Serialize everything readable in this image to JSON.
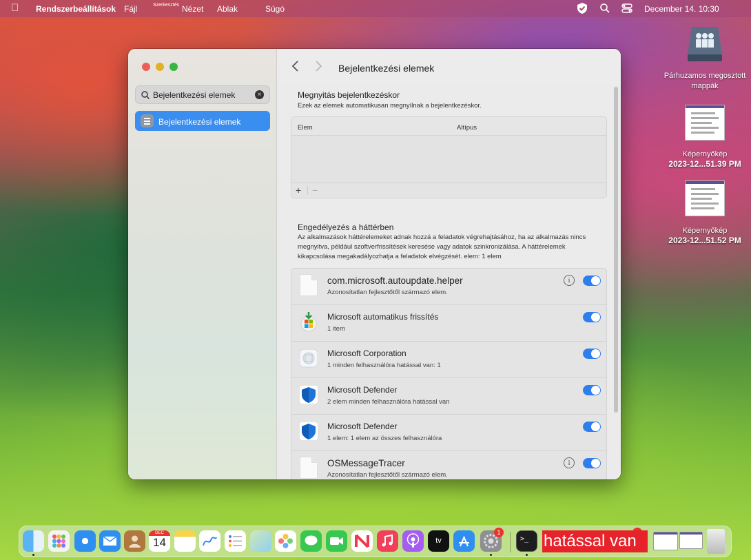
{
  "menubar": {
    "app_name": "Rendszerbeállítások",
    "items": [
      "Fájl",
      "Szerkesztés",
      "Nézet",
      "Ablak",
      "Súgó"
    ],
    "clock": "December 14. 10:30"
  },
  "desktop": {
    "items": [
      {
        "label_1": "Párhuzamos megosztott",
        "label_2": "mappák"
      },
      {
        "label_1": "Képernyőkép",
        "label_2": "2023-12...51.39 PM"
      },
      {
        "label_1": "Képernyőkép",
        "label_2": "2023-12...51.52 PM"
      }
    ]
  },
  "window": {
    "search_value": "Bejelentkezési elemek",
    "sidebar_selected": "Bejelentkezési elemek",
    "title": "Bejelentkezési elemek",
    "open_at_login": {
      "title": "Megnyitás bejelentkezéskor",
      "desc": "Ezek az elemek automatikusan megnyílnak a bejelentkezéskor.",
      "col_item": "Elem",
      "col_kind": "Altípus",
      "add": "+",
      "remove": "−"
    },
    "background": {
      "title": "Engedélyezés a háttérben",
      "desc": "Az alkalmazások háttérelemeket adnak hozzá a feladatok végrehajtásához, ha az alkalmazás nincs megnyitva, például szoftverfrissítések keresése vagy adatok szinkronizálása. A háttérelemek kikapcsolása megakadályozhatja a feladatok elvégzését. elem: 1 elem",
      "items": [
        {
          "name": "com.microsoft.autoupdate.helper",
          "sub": "Azonosítatlan fejlesztőtől származó elem.",
          "icon": "document-icon",
          "info": "i",
          "enabled": true
        },
        {
          "name": "Microsoft automatikus frissítés",
          "sub": "1 item",
          "icon": "microsoft-autoupdate-icon",
          "enabled": true
        },
        {
          "name": "Microsoft Corporation",
          "sub": "1 minden felhasználóra hatással van: 1",
          "icon": "microsoft-corporation-icon",
          "enabled": true
        },
        {
          "name": "Microsoft Defender",
          "sub": "2 elem minden felhasználóra hatással van",
          "icon": "microsoft-defender-icon",
          "enabled": true
        },
        {
          "name": "Microsoft Defender",
          "sub": "1 elem: 1 elem az összes felhasználóra",
          "icon": "microsoft-defender-icon",
          "enabled": true
        },
        {
          "name": "OSMessageTracer",
          "sub": "Azonosítatlan fejlesztőtől származó elem.",
          "icon": "document-icon",
          "info": "i",
          "enabled": true
        }
      ]
    }
  },
  "dock": {
    "calendar_month": "DEC",
    "calendar_day": "14",
    "settings_badge": "1",
    "tv_label": "tv",
    "overlay_text": "hatással van"
  },
  "colors": {
    "accent": "#2f7ef0",
    "sidebar_selection": "#3a8ef0",
    "overlay": "#e8222a"
  }
}
